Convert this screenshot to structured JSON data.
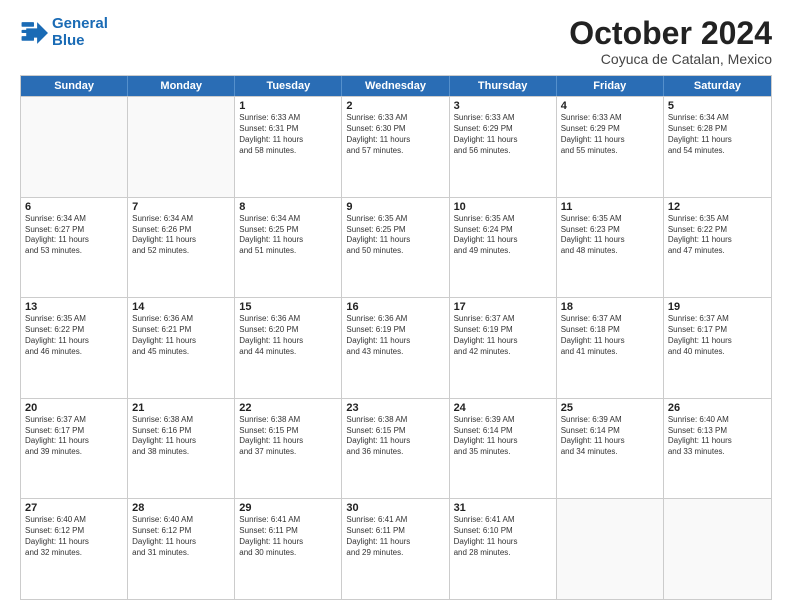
{
  "logo": {
    "line1": "General",
    "line2": "Blue"
  },
  "title": "October 2024",
  "subtitle": "Coyuca de Catalan, Mexico",
  "header_days": [
    "Sunday",
    "Monday",
    "Tuesday",
    "Wednesday",
    "Thursday",
    "Friday",
    "Saturday"
  ],
  "rows": [
    [
      {
        "day": "",
        "text": ""
      },
      {
        "day": "",
        "text": ""
      },
      {
        "day": "1",
        "text": "Sunrise: 6:33 AM\nSunset: 6:31 PM\nDaylight: 11 hours\nand 58 minutes."
      },
      {
        "day": "2",
        "text": "Sunrise: 6:33 AM\nSunset: 6:30 PM\nDaylight: 11 hours\nand 57 minutes."
      },
      {
        "day": "3",
        "text": "Sunrise: 6:33 AM\nSunset: 6:29 PM\nDaylight: 11 hours\nand 56 minutes."
      },
      {
        "day": "4",
        "text": "Sunrise: 6:33 AM\nSunset: 6:29 PM\nDaylight: 11 hours\nand 55 minutes."
      },
      {
        "day": "5",
        "text": "Sunrise: 6:34 AM\nSunset: 6:28 PM\nDaylight: 11 hours\nand 54 minutes."
      }
    ],
    [
      {
        "day": "6",
        "text": "Sunrise: 6:34 AM\nSunset: 6:27 PM\nDaylight: 11 hours\nand 53 minutes."
      },
      {
        "day": "7",
        "text": "Sunrise: 6:34 AM\nSunset: 6:26 PM\nDaylight: 11 hours\nand 52 minutes."
      },
      {
        "day": "8",
        "text": "Sunrise: 6:34 AM\nSunset: 6:25 PM\nDaylight: 11 hours\nand 51 minutes."
      },
      {
        "day": "9",
        "text": "Sunrise: 6:35 AM\nSunset: 6:25 PM\nDaylight: 11 hours\nand 50 minutes."
      },
      {
        "day": "10",
        "text": "Sunrise: 6:35 AM\nSunset: 6:24 PM\nDaylight: 11 hours\nand 49 minutes."
      },
      {
        "day": "11",
        "text": "Sunrise: 6:35 AM\nSunset: 6:23 PM\nDaylight: 11 hours\nand 48 minutes."
      },
      {
        "day": "12",
        "text": "Sunrise: 6:35 AM\nSunset: 6:22 PM\nDaylight: 11 hours\nand 47 minutes."
      }
    ],
    [
      {
        "day": "13",
        "text": "Sunrise: 6:35 AM\nSunset: 6:22 PM\nDaylight: 11 hours\nand 46 minutes."
      },
      {
        "day": "14",
        "text": "Sunrise: 6:36 AM\nSunset: 6:21 PM\nDaylight: 11 hours\nand 45 minutes."
      },
      {
        "day": "15",
        "text": "Sunrise: 6:36 AM\nSunset: 6:20 PM\nDaylight: 11 hours\nand 44 minutes."
      },
      {
        "day": "16",
        "text": "Sunrise: 6:36 AM\nSunset: 6:19 PM\nDaylight: 11 hours\nand 43 minutes."
      },
      {
        "day": "17",
        "text": "Sunrise: 6:37 AM\nSunset: 6:19 PM\nDaylight: 11 hours\nand 42 minutes."
      },
      {
        "day": "18",
        "text": "Sunrise: 6:37 AM\nSunset: 6:18 PM\nDaylight: 11 hours\nand 41 minutes."
      },
      {
        "day": "19",
        "text": "Sunrise: 6:37 AM\nSunset: 6:17 PM\nDaylight: 11 hours\nand 40 minutes."
      }
    ],
    [
      {
        "day": "20",
        "text": "Sunrise: 6:37 AM\nSunset: 6:17 PM\nDaylight: 11 hours\nand 39 minutes."
      },
      {
        "day": "21",
        "text": "Sunrise: 6:38 AM\nSunset: 6:16 PM\nDaylight: 11 hours\nand 38 minutes."
      },
      {
        "day": "22",
        "text": "Sunrise: 6:38 AM\nSunset: 6:15 PM\nDaylight: 11 hours\nand 37 minutes."
      },
      {
        "day": "23",
        "text": "Sunrise: 6:38 AM\nSunset: 6:15 PM\nDaylight: 11 hours\nand 36 minutes."
      },
      {
        "day": "24",
        "text": "Sunrise: 6:39 AM\nSunset: 6:14 PM\nDaylight: 11 hours\nand 35 minutes."
      },
      {
        "day": "25",
        "text": "Sunrise: 6:39 AM\nSunset: 6:14 PM\nDaylight: 11 hours\nand 34 minutes."
      },
      {
        "day": "26",
        "text": "Sunrise: 6:40 AM\nSunset: 6:13 PM\nDaylight: 11 hours\nand 33 minutes."
      }
    ],
    [
      {
        "day": "27",
        "text": "Sunrise: 6:40 AM\nSunset: 6:12 PM\nDaylight: 11 hours\nand 32 minutes."
      },
      {
        "day": "28",
        "text": "Sunrise: 6:40 AM\nSunset: 6:12 PM\nDaylight: 11 hours\nand 31 minutes."
      },
      {
        "day": "29",
        "text": "Sunrise: 6:41 AM\nSunset: 6:11 PM\nDaylight: 11 hours\nand 30 minutes."
      },
      {
        "day": "30",
        "text": "Sunrise: 6:41 AM\nSunset: 6:11 PM\nDaylight: 11 hours\nand 29 minutes."
      },
      {
        "day": "31",
        "text": "Sunrise: 6:41 AM\nSunset: 6:10 PM\nDaylight: 11 hours\nand 28 minutes."
      },
      {
        "day": "",
        "text": ""
      },
      {
        "day": "",
        "text": ""
      }
    ]
  ]
}
